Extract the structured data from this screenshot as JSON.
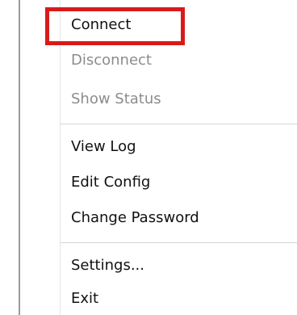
{
  "menu": {
    "items": [
      {
        "label": "Connect",
        "enabled": true
      },
      {
        "label": "Disconnect",
        "enabled": false
      },
      {
        "label": "Show Status",
        "enabled": false
      },
      {
        "label": "View Log",
        "enabled": true
      },
      {
        "label": "Edit Config",
        "enabled": true
      },
      {
        "label": "Change Password",
        "enabled": true
      },
      {
        "label": "Settings...",
        "enabled": true
      },
      {
        "label": "Exit",
        "enabled": true
      }
    ]
  },
  "highlight": {
    "color": "#d91a1a",
    "target": "Connect"
  }
}
